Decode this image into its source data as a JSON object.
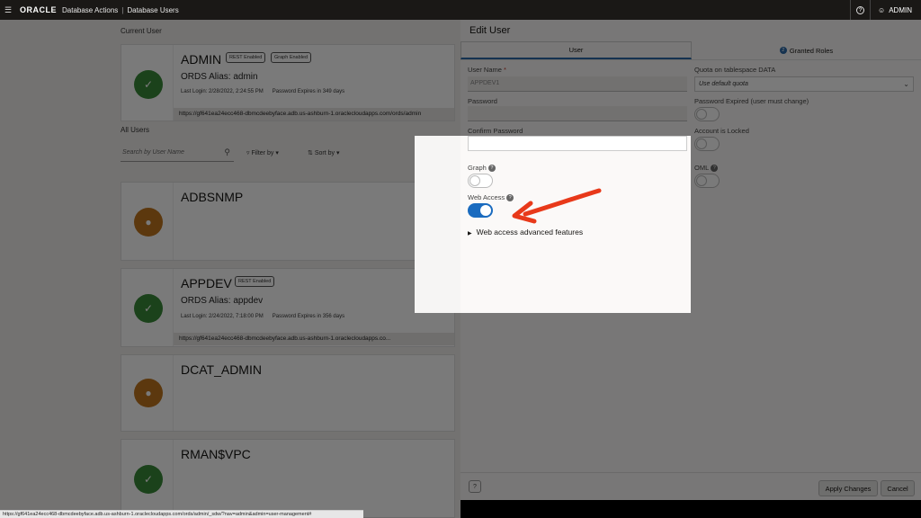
{
  "topbar": {
    "logo": "ORACLE",
    "app": "Database Actions",
    "separator": "|",
    "page": "Database Users",
    "user": "ADMIN",
    "help_glyph": "?"
  },
  "background": {
    "current_user_heading": "Current User",
    "all_users_heading": "All Users",
    "search_placeholder": "Search by User Name",
    "filter_by": "Filter by",
    "sort_by": "Sort by",
    "current": {
      "name": "ADMIN",
      "badges": [
        "REST Enabled",
        "Graph Enabled"
      ],
      "alias": "ORDS Alias: admin",
      "last_login": "Last Login: 2/28/2022, 2:24:55 PM",
      "expires": "Password Expires in 349 days",
      "url": "https://gf641ea24ecc468-dbmcdeebyface.adb.us-ashburn-1.oraclecloudapps.com/ords/admin"
    },
    "users": [
      {
        "name": "ADBSNMP",
        "color": "orange"
      },
      {
        "name": "APPDEV",
        "color": "green",
        "badge": "REST Enabled",
        "alias": "ORDS Alias: appdev",
        "last_login": "Last Login: 2/24/2022, 7:18:00 PM",
        "expires": "Password Expires in 356 days",
        "url": "https://gf641ea24ecc468-dbmcdeebyface.adb.us-ashburn-1.oraclecloudapps.co..."
      },
      {
        "name": "DCAT_ADMIN",
        "color": "orange"
      },
      {
        "name": "RMAN$VPC",
        "color": "green"
      }
    ]
  },
  "drawer": {
    "title": "Edit User",
    "tabs": [
      {
        "label": "User",
        "active": true
      },
      {
        "label": "Granted Roles",
        "count": "2",
        "active": false
      }
    ],
    "user_name_label": "User Name",
    "required_mark": "*",
    "user_name_value": "APPDEV1",
    "password_label": "Password",
    "confirm_password_label": "Confirm Password",
    "quota_label": "Quota on tablespace DATA",
    "quota_value": "Use default quota",
    "password_expired_label": "Password Expired (user must change)",
    "account_locked_label": "Account is Locked",
    "graph_label": "Graph",
    "oml_label": "OML",
    "web_access_label": "Web Access",
    "advanced_label": "Web access advanced features",
    "toggles": {
      "password_expired": false,
      "account_locked": false,
      "graph": false,
      "oml": false,
      "web_access": true
    }
  },
  "footer": {
    "apply": "Apply Changes",
    "cancel": "Cancel",
    "help_glyph": "?"
  },
  "statusbar": {
    "url": "https://gf641ea24ecc468-dbmcdeebyface.adb.us-ashburn-1.oraclecloudapps.com/ords/admin/_sdw/?nav=admin&admin=user-management#"
  },
  "colors": {
    "accent": "#1a6bbf",
    "arrow": "#e8391a"
  }
}
